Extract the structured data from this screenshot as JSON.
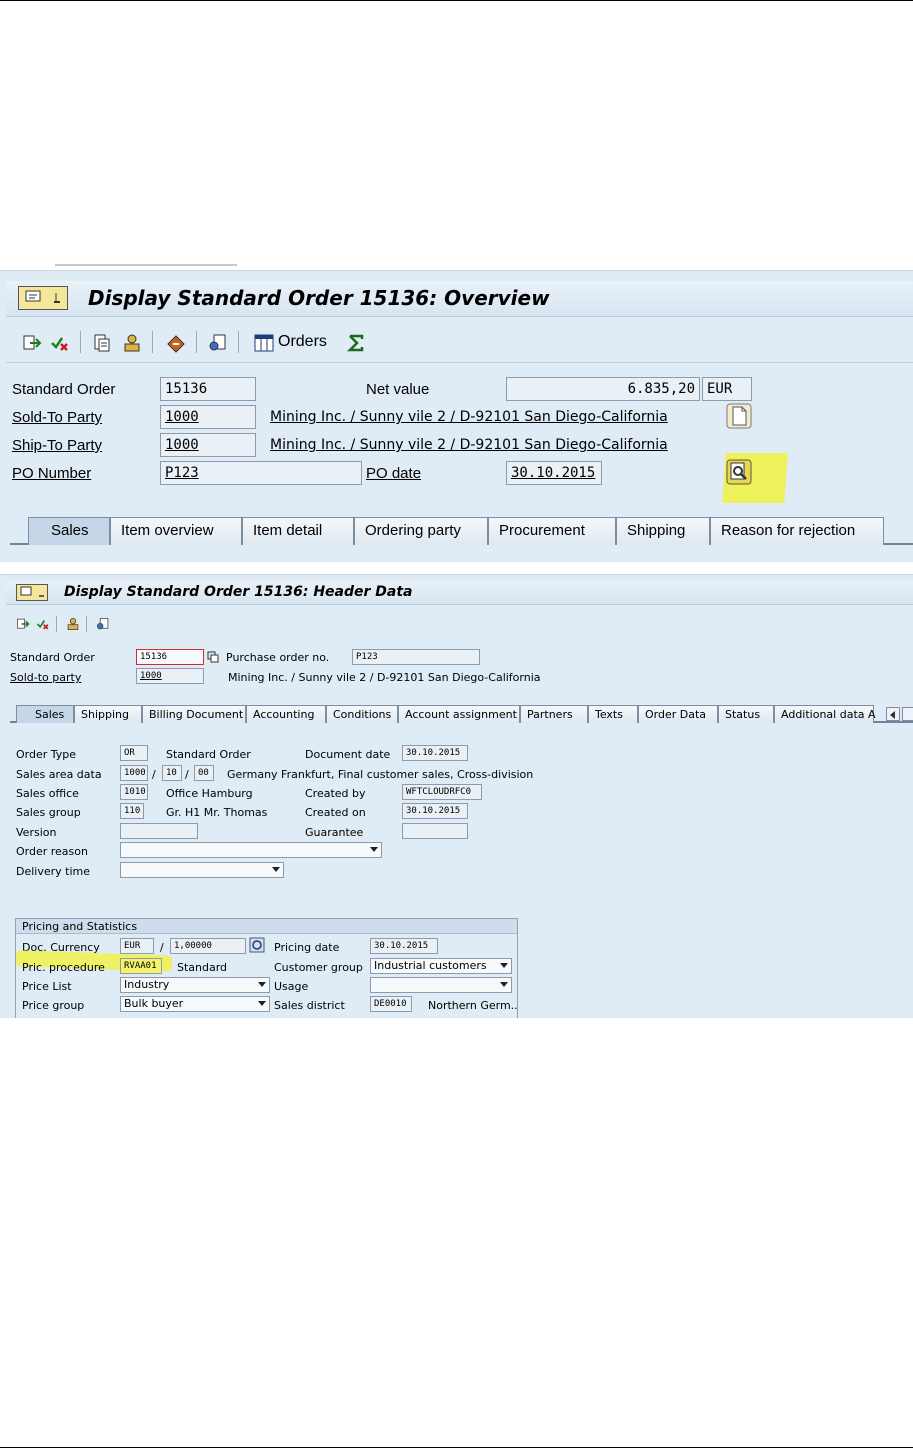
{
  "screen1": {
    "title": "Display Standard Order 15136: Overview",
    "toolbar": {
      "orders_label": "Orders"
    },
    "fields": {
      "standard_order_label": "Standard Order",
      "standard_order_value": "15136",
      "net_value_label": "Net value",
      "net_value_value": "6.835,20",
      "currency_value": "EUR",
      "sold_to_label": "Sold-To Party",
      "sold_to_value": "1000",
      "sold_to_desc": "Mining Inc. / Sunny vile 2 / D-92101 San Diego-California",
      "ship_to_label": "Ship-To Party",
      "ship_to_value": "1000",
      "ship_to_desc": "Mining Inc. / Sunny vile 2 / D-92101 San Diego-California",
      "po_number_label": "PO Number",
      "po_number_value": "P123",
      "po_date_label": "PO date",
      "po_date_value": "30.10.2015"
    },
    "tabs": [
      "Sales",
      "Item overview",
      "Item detail",
      "Ordering party",
      "Procurement",
      "Shipping",
      "Reason for rejection"
    ]
  },
  "screen2": {
    "title": "Display Standard Order 15136: Header Data",
    "header": {
      "standard_order_label": "Standard Order",
      "standard_order_value": "15136",
      "po_no_label": "Purchase order no.",
      "po_no_value": "P123",
      "sold_to_label": "Sold-to party",
      "sold_to_value": "1000",
      "sold_to_desc": "Mining Inc. / Sunny vile 2 / D-92101 San Diego-California"
    },
    "tabs": [
      "Sales",
      "Shipping",
      "Billing Document",
      "Accounting",
      "Conditions",
      "Account assignment",
      "Partners",
      "Texts",
      "Order Data",
      "Status",
      "Additional data A"
    ],
    "sales": {
      "order_type_label": "Order Type",
      "order_type_value": "OR",
      "order_type_desc": "Standard Order",
      "doc_date_label": "Document date",
      "doc_date_value": "30.10.2015",
      "sales_area_label": "Sales area data",
      "sales_org": "1000",
      "dist_channel": "10",
      "division": "00",
      "sep": "/",
      "sales_area_desc": "Germany Frankfurt, Final customer sales, Cross-division",
      "sales_office_label": "Sales office",
      "sales_office_value": "1010",
      "sales_office_desc": "Office Hamburg",
      "created_by_label": "Created by",
      "created_by_value": "WFTCLOUDRFC0",
      "sales_group_label": "Sales group",
      "sales_group_value": "110",
      "sales_group_desc": "Gr. H1 Mr. Thomas",
      "created_on_label": "Created on",
      "created_on_value": "30.10.2015",
      "version_label": "Version",
      "guarantee_label": "Guarantee",
      "order_reason_label": "Order reason",
      "delivery_time_label": "Delivery time"
    },
    "pricing": {
      "group_title": "Pricing and Statistics",
      "doc_currency_label": "Doc. Currency",
      "doc_currency_value": "EUR",
      "sep": "/",
      "exchange_rate": "1,00000",
      "pricing_date_label": "Pricing date",
      "pricing_date_value": "30.10.2015",
      "pric_procedure_label": "Pric. procedure",
      "pric_procedure_value": "RVAA01",
      "pric_procedure_desc": "Standard",
      "customer_group_label": "Customer group",
      "customer_group_value": "Industrial customers",
      "price_list_label": "Price List",
      "price_list_value": "Industry",
      "usage_label": "Usage",
      "price_group_label": "Price group",
      "price_group_value": "Bulk buyer",
      "sales_district_label": "Sales district",
      "sales_district_value": "DE0010",
      "sales_district_desc": "Northern Germ.."
    }
  },
  "colors": {
    "sap_background": "#dfebf5",
    "highlight": "#f1f24a"
  }
}
